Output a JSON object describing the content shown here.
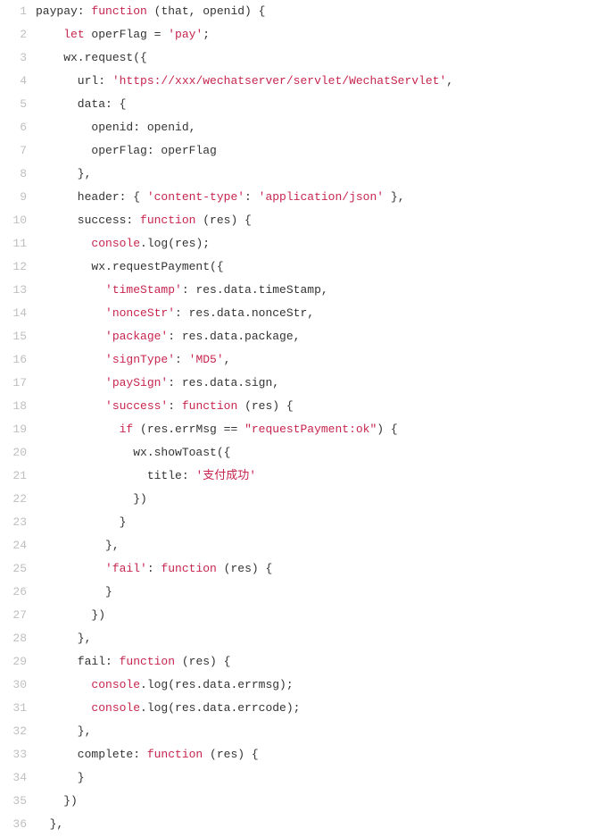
{
  "lineCount": 36,
  "lines": [
    [
      {
        "t": "paypay: ",
        "c": "plain"
      },
      {
        "t": "function",
        "c": "kw"
      },
      {
        "t": " (that, openid) {",
        "c": "plain"
      }
    ],
    [
      {
        "t": "    ",
        "c": "plain"
      },
      {
        "t": "let",
        "c": "kw"
      },
      {
        "t": " operFlag = ",
        "c": "plain"
      },
      {
        "t": "'pay'",
        "c": "str"
      },
      {
        "t": ";",
        "c": "plain"
      }
    ],
    [
      {
        "t": "    wx.request({",
        "c": "plain"
      }
    ],
    [
      {
        "t": "      url: ",
        "c": "plain"
      },
      {
        "t": "'https://xxx/wechatserver/servlet/WechatServlet'",
        "c": "str"
      },
      {
        "t": ",",
        "c": "plain"
      }
    ],
    [
      {
        "t": "      data: {",
        "c": "plain"
      }
    ],
    [
      {
        "t": "        openid: openid,",
        "c": "plain"
      }
    ],
    [
      {
        "t": "        operFlag: operFlag",
        "c": "plain"
      }
    ],
    [
      {
        "t": "      },",
        "c": "plain"
      }
    ],
    [
      {
        "t": "      header: { ",
        "c": "plain"
      },
      {
        "t": "'content-type'",
        "c": "str"
      },
      {
        "t": ": ",
        "c": "plain"
      },
      {
        "t": "'application/json'",
        "c": "str"
      },
      {
        "t": " },",
        "c": "plain"
      }
    ],
    [
      {
        "t": "      success: ",
        "c": "plain"
      },
      {
        "t": "function",
        "c": "kw"
      },
      {
        "t": " (res) {",
        "c": "plain"
      }
    ],
    [
      {
        "t": "        ",
        "c": "plain"
      },
      {
        "t": "console",
        "c": "obj"
      },
      {
        "t": ".log(res);",
        "c": "plain"
      }
    ],
    [
      {
        "t": "        wx.requestPayment({",
        "c": "plain"
      }
    ],
    [
      {
        "t": "          ",
        "c": "plain"
      },
      {
        "t": "'timeStamp'",
        "c": "str"
      },
      {
        "t": ": res.data.timeStamp,",
        "c": "plain"
      }
    ],
    [
      {
        "t": "          ",
        "c": "plain"
      },
      {
        "t": "'nonceStr'",
        "c": "str"
      },
      {
        "t": ": res.data.nonceStr,",
        "c": "plain"
      }
    ],
    [
      {
        "t": "          ",
        "c": "plain"
      },
      {
        "t": "'package'",
        "c": "str"
      },
      {
        "t": ": res.data.package,",
        "c": "plain"
      }
    ],
    [
      {
        "t": "          ",
        "c": "plain"
      },
      {
        "t": "'signType'",
        "c": "str"
      },
      {
        "t": ": ",
        "c": "plain"
      },
      {
        "t": "'MD5'",
        "c": "str"
      },
      {
        "t": ",",
        "c": "plain"
      }
    ],
    [
      {
        "t": "          ",
        "c": "plain"
      },
      {
        "t": "'paySign'",
        "c": "str"
      },
      {
        "t": ": res.data.sign,",
        "c": "plain"
      }
    ],
    [
      {
        "t": "          ",
        "c": "plain"
      },
      {
        "t": "'success'",
        "c": "str"
      },
      {
        "t": ": ",
        "c": "plain"
      },
      {
        "t": "function",
        "c": "kw"
      },
      {
        "t": " (res) {",
        "c": "plain"
      }
    ],
    [
      {
        "t": "            ",
        "c": "plain"
      },
      {
        "t": "if",
        "c": "kw"
      },
      {
        "t": " (res.errMsg == ",
        "c": "plain"
      },
      {
        "t": "\"requestPayment:ok\"",
        "c": "str"
      },
      {
        "t": ") {",
        "c": "plain"
      }
    ],
    [
      {
        "t": "              wx.showToast({",
        "c": "plain"
      }
    ],
    [
      {
        "t": "                title: ",
        "c": "plain"
      },
      {
        "t": "'支付成功'",
        "c": "str"
      }
    ],
    [
      {
        "t": "              })",
        "c": "plain"
      }
    ],
    [
      {
        "t": "            }",
        "c": "plain"
      }
    ],
    [
      {
        "t": "          },",
        "c": "plain"
      }
    ],
    [
      {
        "t": "          ",
        "c": "plain"
      },
      {
        "t": "'fail'",
        "c": "str"
      },
      {
        "t": ": ",
        "c": "plain"
      },
      {
        "t": "function",
        "c": "kw"
      },
      {
        "t": " (res) {",
        "c": "plain"
      }
    ],
    [
      {
        "t": "          }",
        "c": "plain"
      }
    ],
    [
      {
        "t": "        })",
        "c": "plain"
      }
    ],
    [
      {
        "t": "      },",
        "c": "plain"
      }
    ],
    [
      {
        "t": "      fail: ",
        "c": "plain"
      },
      {
        "t": "function",
        "c": "kw"
      },
      {
        "t": " (res) {",
        "c": "plain"
      }
    ],
    [
      {
        "t": "        ",
        "c": "plain"
      },
      {
        "t": "console",
        "c": "obj"
      },
      {
        "t": ".log(res.data.errmsg);",
        "c": "plain"
      }
    ],
    [
      {
        "t": "        ",
        "c": "plain"
      },
      {
        "t": "console",
        "c": "obj"
      },
      {
        "t": ".log(res.data.errcode);",
        "c": "plain"
      }
    ],
    [
      {
        "t": "      },",
        "c": "plain"
      }
    ],
    [
      {
        "t": "      complete: ",
        "c": "plain"
      },
      {
        "t": "function",
        "c": "kw"
      },
      {
        "t": " (res) {",
        "c": "plain"
      }
    ],
    [
      {
        "t": "      }",
        "c": "plain"
      }
    ],
    [
      {
        "t": "    })",
        "c": "plain"
      }
    ],
    [
      {
        "t": "  },",
        "c": "plain"
      }
    ]
  ]
}
